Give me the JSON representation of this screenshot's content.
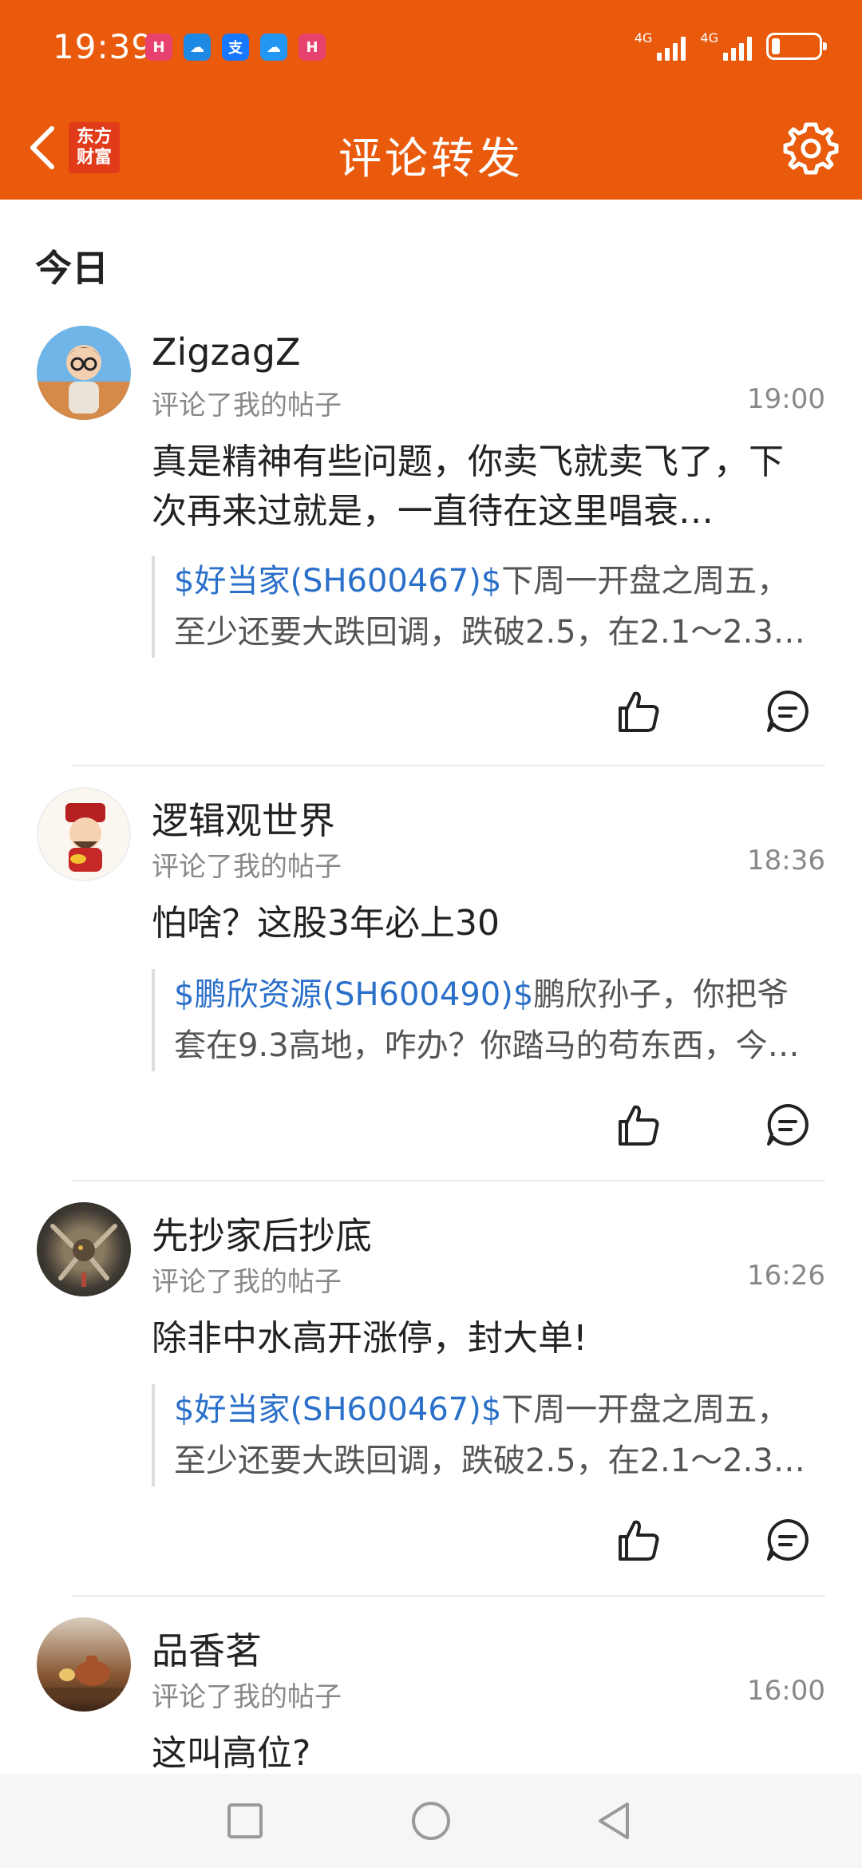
{
  "status": {
    "time": "19:39",
    "apps": [
      {
        "name": "huawei-app-icon",
        "label": "H",
        "color": "#e8416d"
      },
      {
        "name": "weather-app-icon",
        "label": "☁",
        "color": "#1e88e5"
      },
      {
        "name": "alipay-app-icon",
        "label": "支",
        "color": "#1677ff"
      },
      {
        "name": "cloud-app-icon",
        "label": "☁",
        "color": "#2196f3"
      },
      {
        "name": "huawei-app-icon-2",
        "label": "H",
        "color": "#e8416d"
      }
    ],
    "net1": "4G",
    "net2": "4G"
  },
  "header": {
    "logo_line1": "东方",
    "logo_line2": "财富",
    "title": "评论转发"
  },
  "section": {
    "title": "今日"
  },
  "items": [
    {
      "username": "ZigzagZ",
      "action": "评论了我的帖子",
      "time": "19:00",
      "content": "真是精神有些问题，你卖飞就卖飞了，下次再来过就是，一直待在这里唱衰…",
      "quote_link": "$好当家(SH600467)$",
      "quote_text1": "下周一开盘之周五，",
      "quote_text2": "至少还要大跌回调，跌破2.5，在2.1～2.3…"
    },
    {
      "username": "逻辑观世界",
      "action": "评论了我的帖子",
      "time": "18:36",
      "content": "怕啥？这股3年必上30",
      "quote_link": "$鹏欣资源(SH600490)$",
      "quote_text1": "鹏欣孙子，你把爷",
      "quote_text2": "套在9.3高地，咋办？你踏马的苟东西，今…"
    },
    {
      "username": "先抄家后抄底",
      "action": "评论了我的帖子",
      "time": "16:26",
      "content": "除非中水高开涨停，封大单!",
      "quote_link": "$好当家(SH600467)$",
      "quote_text1": "下周一开盘之周五，",
      "quote_text2": "至少还要大跌回调，跌破2.5，在2.1～2.3…"
    },
    {
      "username": "品香茗",
      "action": "评论了我的帖子",
      "time": "16:00",
      "content": "这叫高位?"
    }
  ],
  "colors": {
    "brand": "#e95a0c",
    "link": "#2a6fc9"
  }
}
